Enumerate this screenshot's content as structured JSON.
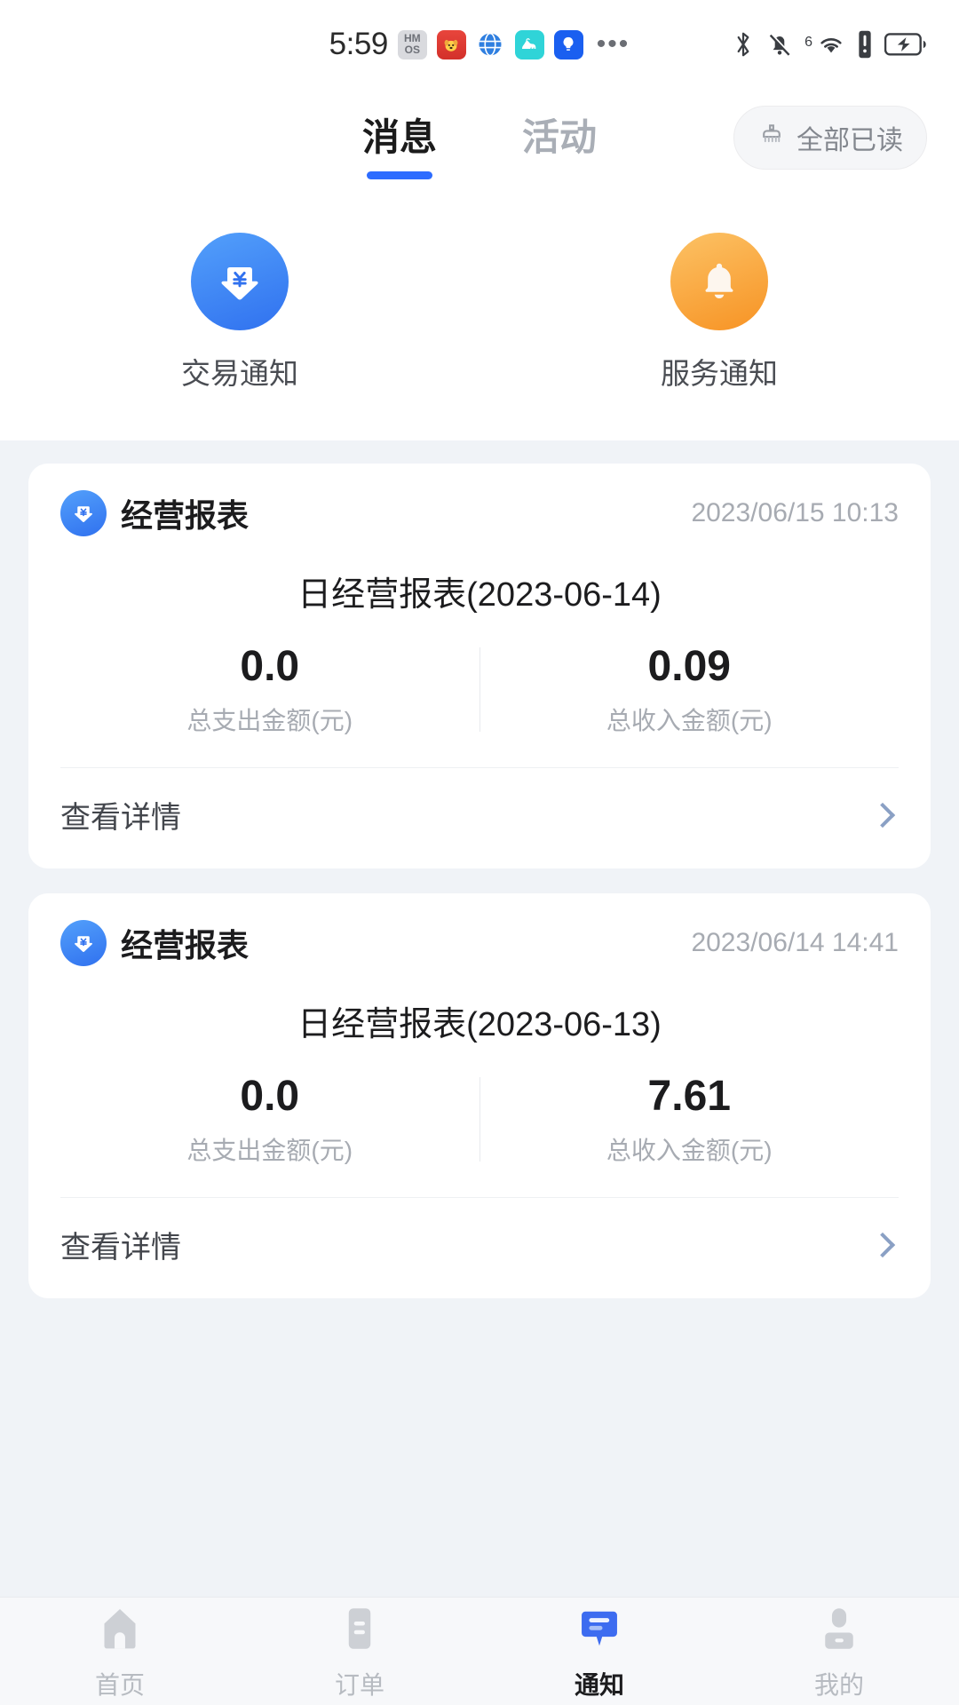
{
  "statusbar": {
    "time": "5:59",
    "apps": [
      {
        "name": "hmos-badge",
        "glyph": "HM\nOS"
      },
      {
        "name": "red-app-icon",
        "glyph": "🐶"
      },
      {
        "name": "globe-app-icon",
        "glyph": "🌐"
      },
      {
        "name": "camel-app-icon",
        "glyph": "🐫"
      },
      {
        "name": "bulb-app-icon",
        "glyph": "💡"
      }
    ],
    "overflow": "•••",
    "network_label": "6",
    "icons": [
      "bluetooth-icon",
      "mute-bell-icon",
      "wifi-icon",
      "sim-alert-icon",
      "battery-charging-icon"
    ]
  },
  "header": {
    "tabs": [
      {
        "label": "消息",
        "active": true
      },
      {
        "label": "活动",
        "active": false
      }
    ],
    "read_all_label": "全部已读",
    "read_all_icon": "broom-icon"
  },
  "categories": [
    {
      "label": "交易通知",
      "icon": "yen-download-icon",
      "color": "#3071ef"
    },
    {
      "label": "服务通知",
      "icon": "bell-icon",
      "color": "#f79324"
    }
  ],
  "messages": [
    {
      "source": "经营报表",
      "time": "2023/06/15 10:13",
      "title": "日经营报表(2023-06-14)",
      "stats": [
        {
          "value": "0.0",
          "label": "总支出金额(元)"
        },
        {
          "value": "0.09",
          "label": "总收入金额(元)"
        }
      ],
      "action": "查看详情"
    },
    {
      "source": "经营报表",
      "time": "2023/06/14 14:41",
      "title": "日经营报表(2023-06-13)",
      "stats": [
        {
          "value": "0.0",
          "label": "总支出金额(元)"
        },
        {
          "value": "7.61",
          "label": "总收入金额(元)"
        }
      ],
      "action": "查看详情"
    }
  ],
  "tabbar": [
    {
      "label": "首页",
      "icon": "home-icon",
      "active": false
    },
    {
      "label": "订单",
      "icon": "order-list-icon",
      "active": false
    },
    {
      "label": "通知",
      "icon": "chat-bubble-icon",
      "active": true
    },
    {
      "label": "我的",
      "icon": "person-icon",
      "active": false
    }
  ],
  "colors": {
    "accent": "#2d6cff",
    "income": "#1c1c1e",
    "page_bg": "#f0f3f7"
  }
}
